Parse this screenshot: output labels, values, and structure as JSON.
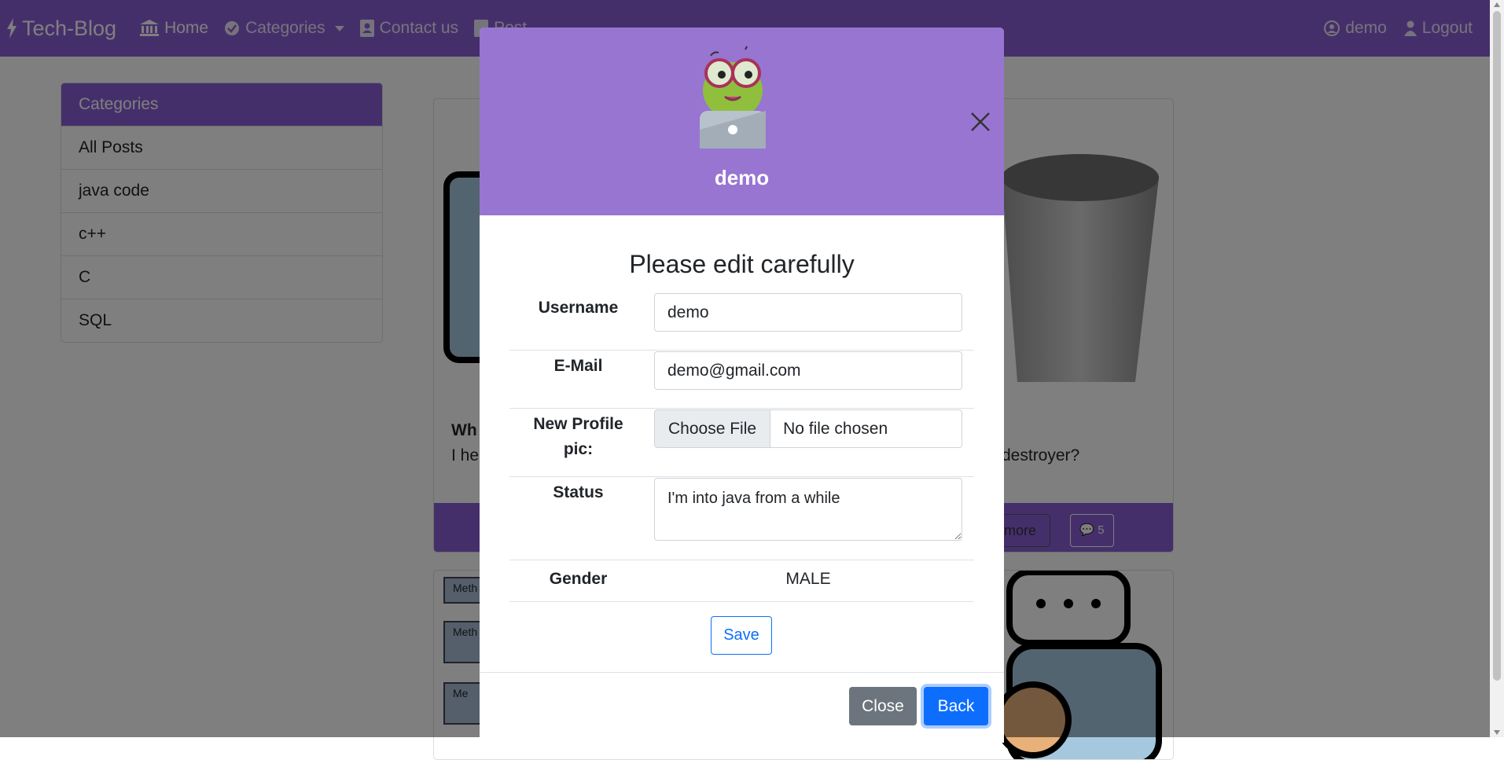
{
  "navbar": {
    "brand": "Tech-Blog",
    "items": [
      {
        "label": "Home",
        "icon": "bank-icon"
      },
      {
        "label": "Categories",
        "icon": "check-circle-icon"
      },
      {
        "label": "Contact us",
        "icon": "contact-card-icon"
      },
      {
        "label": "Post",
        "icon": "post-icon"
      }
    ],
    "user_label": "demo",
    "logout_label": "Logout",
    "color": "#8b5fd6"
  },
  "sidebar": {
    "header": "Categories",
    "items": [
      "All Posts",
      "java code",
      "c++",
      "C",
      "SQL"
    ]
  },
  "post": {
    "title_fragment": "Wh",
    "text_fragment": "I he",
    "text_fragment_right": "destroyer?",
    "readmore_fragment": "ad more",
    "comment_count": "5",
    "method_labels": [
      "Meth",
      "Meth",
      "Me"
    ]
  },
  "modal": {
    "header_color": "#9775d1",
    "username": "demo",
    "form_title": "Please edit carefully",
    "fields": {
      "username_label": "Username",
      "username_value": "demo",
      "email_label": "E-Mail",
      "email_value": "demo@gmail.com",
      "profile_pic_label_line1": "New Profile",
      "profile_pic_label_line2": "pic:",
      "file_button": "Choose File",
      "file_status": "No file chosen",
      "status_label": "Status",
      "status_value": "I'm into java from a while",
      "gender_label": "Gender",
      "gender_value": "MALE"
    },
    "save_label": "Save",
    "close_label": "Close",
    "back_label": "Back"
  }
}
